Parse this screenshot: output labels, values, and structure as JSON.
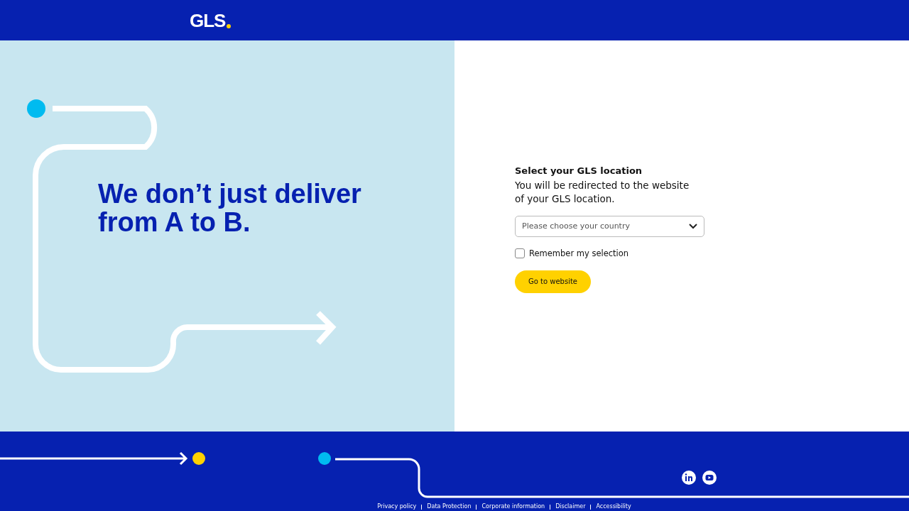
{
  "header": {
    "logo": "GLS"
  },
  "hero": {
    "headline": "We don’t just deliver from A to B."
  },
  "location_form": {
    "title": "Select your GLS location",
    "description": "You will be redirected to the website of your GLS location.",
    "country_select": {
      "placeholder": "Please choose your country"
    },
    "remember": {
      "label": "Remember my selection",
      "checked": false
    },
    "button": "Go to website"
  },
  "footer": {
    "links": [
      "Privacy policy",
      "Data Protection",
      "Corporate information",
      "Disclaimer",
      "Accessibility"
    ]
  }
}
